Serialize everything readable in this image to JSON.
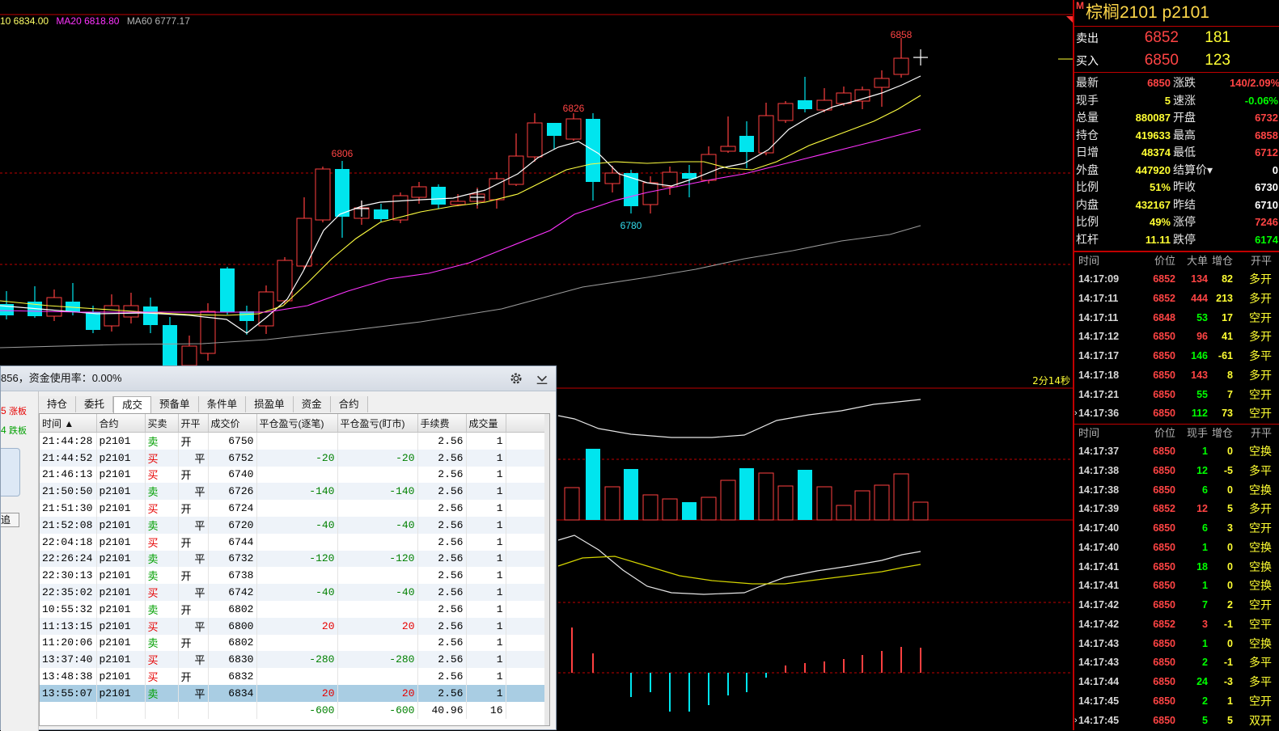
{
  "ma_header": {
    "ma10": "10 6834.00",
    "ma20": "MA20 6818.80",
    "ma60": "MA60 6777.17"
  },
  "timer_label": "2分14秒",
  "price_labels": {
    "high1": "6806",
    "high2": "6826",
    "low1": "6780",
    "high3": "6858"
  },
  "colors": {
    "up": "#ff4040",
    "down": "#00e5ee",
    "ma10": "#ffffff",
    "ma20": "#ffff40",
    "ma60": "#ff33ff",
    "ma120": "#9a9a9a",
    "grid": "#c00000"
  },
  "quote": {
    "badge": "M",
    "title": "棕榈2101  p2101",
    "sell": {
      "label": "卖出",
      "price": "6852",
      "vol": "181"
    },
    "buy": {
      "label": "买入",
      "price": "6850",
      "vol": "123"
    },
    "info": [
      {
        "l1": "最新",
        "v1": "6850",
        "c1": "#ff4444",
        "l2": "涨跌",
        "v2": "140/2.09%",
        "c2": "#ff4444"
      },
      {
        "l1": "现手",
        "v1": "5",
        "c1": "#ffff33",
        "l2": "速涨",
        "v2": "-0.06%",
        "c2": "#00ff00"
      },
      {
        "l1": "总量",
        "v1": "880087",
        "c1": "#ffff33",
        "l2": "开盘",
        "v2": "6732",
        "c2": "#ff4444"
      },
      {
        "l1": "持仓",
        "v1": "419633",
        "c1": "#ffff33",
        "l2": "最高",
        "v2": "6858",
        "c2": "#ff4444"
      },
      {
        "l1": "日增",
        "v1": "48374",
        "c1": "#ffff33",
        "l2": "最低",
        "v2": "6712",
        "c2": "#ff4444"
      },
      {
        "l1": "外盘",
        "v1": "447920",
        "c1": "#ffff33",
        "l2": "结算价▾",
        "v2": "0",
        "c2": "#ffffff"
      },
      {
        "l1": "比例",
        "v1": "51%",
        "c1": "#ffff33",
        "l2": "昨收",
        "v2": "6730",
        "c2": "#ffffff"
      },
      {
        "l1": "内盘",
        "v1": "432167",
        "c1": "#ffff33",
        "l2": "昨结",
        "v2": "6710",
        "c2": "#ffffff"
      },
      {
        "l1": "比例",
        "v1": "49%",
        "c1": "#ffff33",
        "l2": "涨停",
        "v2": "7246",
        "c2": "#ff4444"
      },
      {
        "l1": "杠杆",
        "v1": "11.11",
        "c1": "#ffff33",
        "l2": "跌停",
        "v2": "6174",
        "c2": "#00ff00"
      }
    ],
    "ticks1_head": [
      "时间",
      "价位",
      "大单",
      "增仓",
      "开平"
    ],
    "ticks1": [
      {
        "t": "14:17:09",
        "p": "6852",
        "v": "134",
        "vc": "#ff4444",
        "c": "82",
        "k": "多开",
        "kc": "#ffff33"
      },
      {
        "t": "14:17:11",
        "p": "6852",
        "v": "444",
        "vc": "#ff4444",
        "c": "213",
        "k": "多开",
        "kc": "#ffff33"
      },
      {
        "t": "14:17:11",
        "p": "6848",
        "v": "53",
        "vc": "#00ff00",
        "c": "17",
        "k": "空开",
        "kc": "#ffff33"
      },
      {
        "t": "14:17:12",
        "p": "6850",
        "v": "96",
        "vc": "#ff4444",
        "c": "41",
        "k": "多开",
        "kc": "#ffff33"
      },
      {
        "t": "14:17:17",
        "p": "6850",
        "v": "146",
        "vc": "#00ff00",
        "c": "-61",
        "k": "多平",
        "kc": "#ffff33"
      },
      {
        "t": "14:17:18",
        "p": "6850",
        "v": "143",
        "vc": "#ff4444",
        "c": "8",
        "k": "多开",
        "kc": "#ffff33"
      },
      {
        "t": "14:17:21",
        "p": "6850",
        "v": "55",
        "vc": "#00ff00",
        "c": "7",
        "k": "空开",
        "kc": "#ffff33"
      },
      {
        "t": "14:17:36",
        "p": "6850",
        "v": "112",
        "vc": "#00ff00",
        "c": "73",
        "k": "空开",
        "kc": "#ffff33",
        "arrow": true
      }
    ],
    "ticks2_head": [
      "时间",
      "价位",
      "现手",
      "增仓",
      "开平"
    ],
    "ticks2": [
      {
        "t": "14:17:37",
        "p": "6850",
        "v": "1",
        "vc": "#00ff00",
        "c": "0",
        "k": "空换",
        "kc": "#ffff33"
      },
      {
        "t": "14:17:38",
        "p": "6850",
        "v": "12",
        "vc": "#00ff00",
        "c": "-5",
        "k": "多平",
        "kc": "#ffff33"
      },
      {
        "t": "14:17:38",
        "p": "6850",
        "v": "6",
        "vc": "#00ff00",
        "c": "0",
        "k": "空换",
        "kc": "#ffff33"
      },
      {
        "t": "14:17:39",
        "p": "6852",
        "v": "12",
        "vc": "#ff4444",
        "c": "5",
        "k": "多开",
        "kc": "#ffff33"
      },
      {
        "t": "14:17:40",
        "p": "6850",
        "v": "6",
        "vc": "#00ff00",
        "c": "3",
        "k": "空开",
        "kc": "#ffff33"
      },
      {
        "t": "14:17:40",
        "p": "6850",
        "v": "1",
        "vc": "#00ff00",
        "c": "0",
        "k": "空换",
        "kc": "#ffff33"
      },
      {
        "t": "14:17:41",
        "p": "6850",
        "v": "18",
        "vc": "#00ff00",
        "c": "0",
        "k": "空换",
        "kc": "#ffff33"
      },
      {
        "t": "14:17:41",
        "p": "6850",
        "v": "1",
        "vc": "#00ff00",
        "c": "0",
        "k": "空换",
        "kc": "#ffff33"
      },
      {
        "t": "14:17:42",
        "p": "6850",
        "v": "7",
        "vc": "#00ff00",
        "c": "2",
        "k": "空开",
        "kc": "#ffff33"
      },
      {
        "t": "14:17:42",
        "p": "6852",
        "v": "3",
        "vc": "#ff4444",
        "c": "-1",
        "k": "空平",
        "kc": "#ffff33"
      },
      {
        "t": "14:17:43",
        "p": "6850",
        "v": "1",
        "vc": "#00ff00",
        "c": "0",
        "k": "空换",
        "kc": "#ffff33"
      },
      {
        "t": "14:17:43",
        "p": "6850",
        "v": "2",
        "vc": "#00ff00",
        "c": "-1",
        "k": "多平",
        "kc": "#ffff33"
      },
      {
        "t": "14:17:44",
        "p": "6850",
        "v": "24",
        "vc": "#00ff00",
        "c": "-3",
        "k": "多平",
        "kc": "#ffff33"
      },
      {
        "t": "14:17:45",
        "p": "6850",
        "v": "2",
        "vc": "#00ff00",
        "c": "1",
        "k": "空开",
        "kc": "#ffff33"
      },
      {
        "t": "14:17:45",
        "p": "6850",
        "v": "5",
        "vc": "#00ff00",
        "c": "5",
        "k": "双开",
        "kc": "#ffff33",
        "arrow": true
      }
    ]
  },
  "dialog": {
    "title": "856，资金使用率：0.00%",
    "left_top": "5",
    "left_top_tag": "涨板",
    "left_mid": "4",
    "left_mid_tag": "跌板",
    "left_btn": "追",
    "tabs": [
      "持仓",
      "委托",
      "成交",
      "预备单",
      "条件单",
      "损盈单",
      "资金",
      "合约"
    ],
    "active_tab": 2,
    "columns": [
      "时间 ▲",
      "合约",
      "买卖",
      "开平",
      "成交价",
      "平仓盈亏(逐笔)",
      "平仓盈亏(盯市)",
      "手续费",
      "成交量"
    ],
    "rows": [
      {
        "time": "21:44:28",
        "sym": "p2101",
        "side": "卖",
        "oc": "开",
        "price": "6750",
        "pl1": "",
        "pl2": "",
        "fee": "2.56",
        "qty": "1"
      },
      {
        "time": "21:44:52",
        "sym": "p2101",
        "side": "买",
        "oc": "平",
        "price": "6752",
        "pl1": "-20",
        "pl2": "-20",
        "fee": "2.56",
        "qty": "1"
      },
      {
        "time": "21:46:13",
        "sym": "p2101",
        "side": "买",
        "oc": "开",
        "price": "6740",
        "pl1": "",
        "pl2": "",
        "fee": "2.56",
        "qty": "1"
      },
      {
        "time": "21:50:50",
        "sym": "p2101",
        "side": "卖",
        "oc": "平",
        "price": "6726",
        "pl1": "-140",
        "pl2": "-140",
        "fee": "2.56",
        "qty": "1"
      },
      {
        "time": "21:51:30",
        "sym": "p2101",
        "side": "买",
        "oc": "开",
        "price": "6724",
        "pl1": "",
        "pl2": "",
        "fee": "2.56",
        "qty": "1"
      },
      {
        "time": "21:52:08",
        "sym": "p2101",
        "side": "卖",
        "oc": "平",
        "price": "6720",
        "pl1": "-40",
        "pl2": "-40",
        "fee": "2.56",
        "qty": "1"
      },
      {
        "time": "22:04:18",
        "sym": "p2101",
        "side": "买",
        "oc": "开",
        "price": "6744",
        "pl1": "",
        "pl2": "",
        "fee": "2.56",
        "qty": "1"
      },
      {
        "time": "22:26:24",
        "sym": "p2101",
        "side": "卖",
        "oc": "平",
        "price": "6732",
        "pl1": "-120",
        "pl2": "-120",
        "fee": "2.56",
        "qty": "1"
      },
      {
        "time": "22:30:13",
        "sym": "p2101",
        "side": "卖",
        "oc": "开",
        "price": "6738",
        "pl1": "",
        "pl2": "",
        "fee": "2.56",
        "qty": "1"
      },
      {
        "time": "22:35:02",
        "sym": "p2101",
        "side": "买",
        "oc": "平",
        "price": "6742",
        "pl1": "-40",
        "pl2": "-40",
        "fee": "2.56",
        "qty": "1"
      },
      {
        "time": "10:55:32",
        "sym": "p2101",
        "side": "卖",
        "oc": "开",
        "price": "6802",
        "pl1": "",
        "pl2": "",
        "fee": "2.56",
        "qty": "1"
      },
      {
        "time": "11:13:15",
        "sym": "p2101",
        "side": "买",
        "oc": "平",
        "price": "6800",
        "pl1": "20",
        "pl2": "20",
        "fee": "2.56",
        "qty": "1"
      },
      {
        "time": "11:20:06",
        "sym": "p2101",
        "side": "卖",
        "oc": "开",
        "price": "6802",
        "pl1": "",
        "pl2": "",
        "fee": "2.56",
        "qty": "1"
      },
      {
        "time": "13:37:40",
        "sym": "p2101",
        "side": "买",
        "oc": "平",
        "price": "6830",
        "pl1": "-280",
        "pl2": "-280",
        "fee": "2.56",
        "qty": "1"
      },
      {
        "time": "13:48:38",
        "sym": "p2101",
        "side": "买",
        "oc": "开",
        "price": "6832",
        "pl1": "",
        "pl2": "",
        "fee": "2.56",
        "qty": "1"
      },
      {
        "time": "13:55:07",
        "sym": "p2101",
        "side": "卖",
        "oc": "平",
        "price": "6834",
        "pl1": "20",
        "pl2": "20",
        "fee": "2.56",
        "qty": "1"
      }
    ],
    "total": {
      "pl1": "-600",
      "pl2": "-600",
      "fee": "40.96",
      "qty": "16"
    }
  }
}
